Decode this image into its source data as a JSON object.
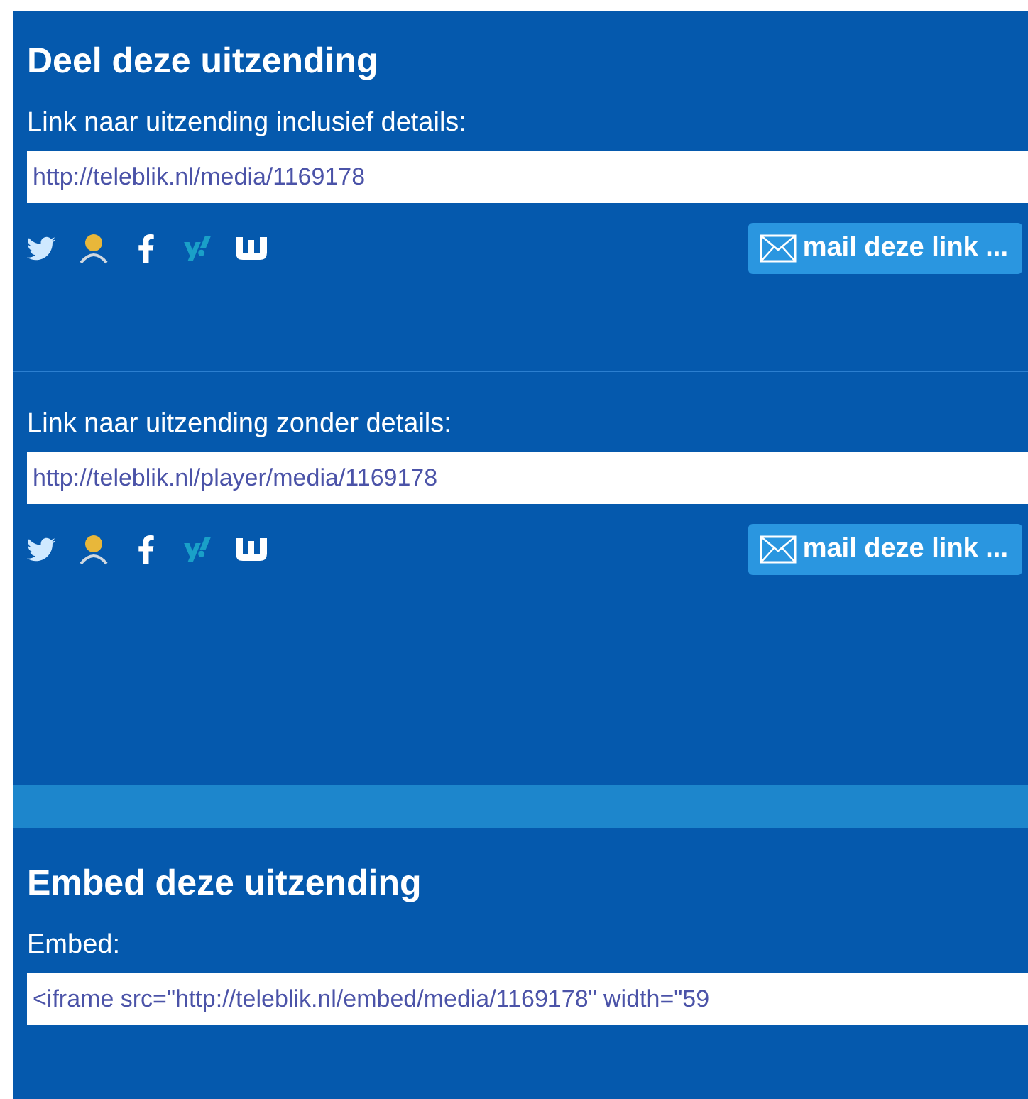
{
  "share": {
    "title": "Deel deze uitzending",
    "links": [
      {
        "label": "Link naar uitzending inclusief details:",
        "value": "http://teleblik.nl/media/1169178",
        "mail_button": "mail deze link ..."
      },
      {
        "label": "Link naar uitzending zonder details:",
        "value": "http://teleblik.nl/player/media/1169178",
        "mail_button": "mail deze link ..."
      }
    ]
  },
  "embed": {
    "title": "Embed deze uitzending",
    "label": "Embed:",
    "value": "<iframe src=\"http://teleblik.nl/embed/media/1169178\" width=\"59"
  }
}
